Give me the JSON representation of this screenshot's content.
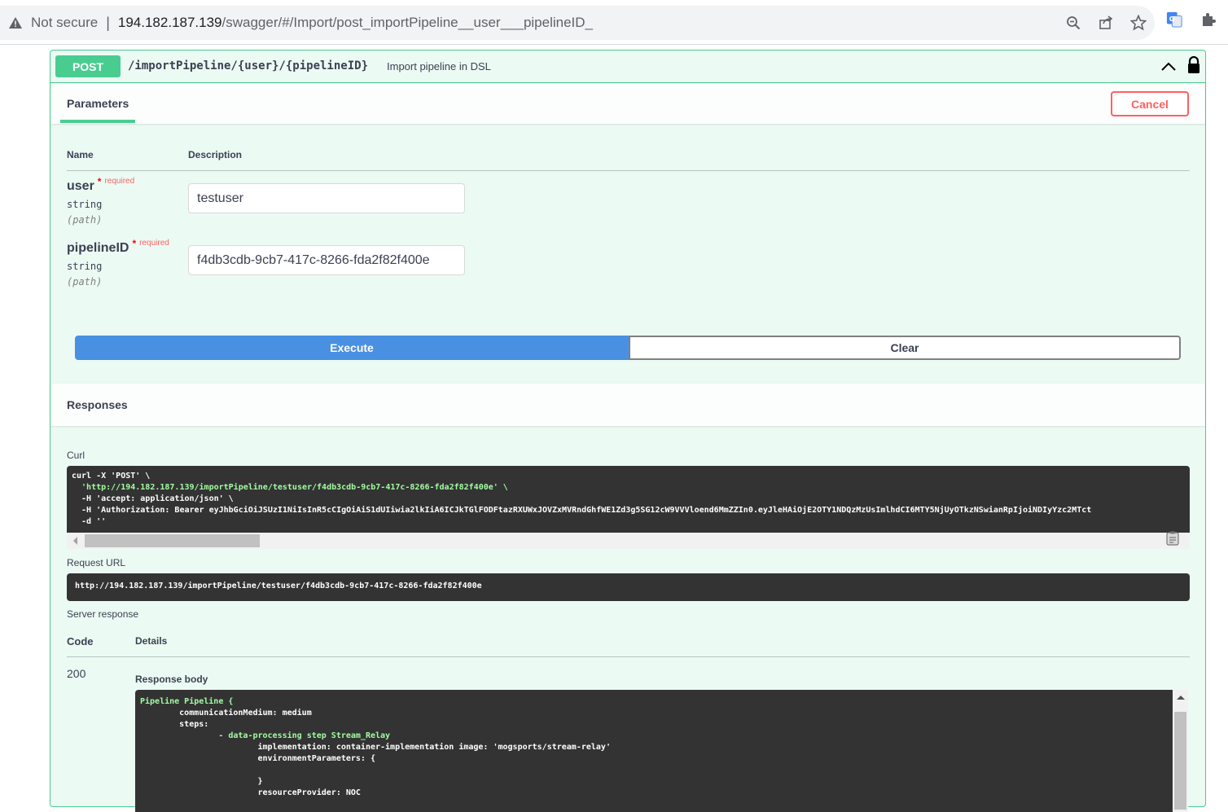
{
  "browser": {
    "security_label": "Not secure",
    "separator": "|",
    "url_host": "194.182.187.139",
    "url_path": "/swagger/#/Import/post_importPipeline__user___pipelineID_"
  },
  "operation": {
    "method": "POST",
    "path": "/importPipeline/{user}/{pipelineID}",
    "description": "Import pipeline in DSL"
  },
  "parameters": {
    "tab_label": "Parameters",
    "cancel_label": "Cancel",
    "col_name": "Name",
    "col_description": "Description",
    "items": [
      {
        "name": "user",
        "star": "*",
        "required": "required",
        "type": "string",
        "in": "(path)",
        "value": "testuser"
      },
      {
        "name": "pipelineID",
        "star": "*",
        "required": "required",
        "type": "string",
        "in": "(path)",
        "value": "f4db3cdb-9cb7-417c-8266-fda2f82f400e"
      }
    ]
  },
  "actions": {
    "execute_label": "Execute",
    "clear_label": "Clear"
  },
  "responses": {
    "title": "Responses",
    "curl_label": "Curl",
    "curl_lines": [
      "curl -X 'POST' \\",
      "  'http://194.182.187.139/importPipeline/testuser/f4db3cdb-9cb7-417c-8266-fda2f82f400e' \\",
      "  -H 'accept: application/json' \\",
      "  -H 'Authorization: Bearer eyJhbGciOiJSUzI1NiIsInR5cCIgOiAiS1dUIiwia2lkIiA6ICJkTGlFODFtazRXUWxJOVZxMVRndGhfWE1Zd3g5SG12cW9VVVloend6MmZZIn0.eyJleHAiOjE2OTY1NDQzMzUsImlhdCI6MTY5NjUyOTkzNSwianRpIjoiNDIyYzc2MTct",
      "  -d ''"
    ],
    "request_url_label": "Request URL",
    "request_url": "http://194.182.187.139/importPipeline/testuser/f4db3cdb-9cb7-417c-8266-fda2f82f400e",
    "server_response_label": "Server response",
    "code_header": "Code",
    "details_header": "Details",
    "code": "200",
    "response_body_label": "Response body",
    "response_body_lines": [
      "Pipeline Pipeline {",
      "        communicationMedium: medium",
      "        steps:",
      "                - data-processing step Stream_Relay",
      "                        implementation: container-implementation image: 'mogsports/stream-relay'",
      "                        environmentParameters: {",
      "",
      "                        }",
      "                        resourceProvider: NOC"
    ]
  },
  "colors": {
    "post_green": "#49cc90",
    "execute_blue": "#4990e2",
    "cancel_red": "#ff6060",
    "code_bg": "#333333"
  }
}
